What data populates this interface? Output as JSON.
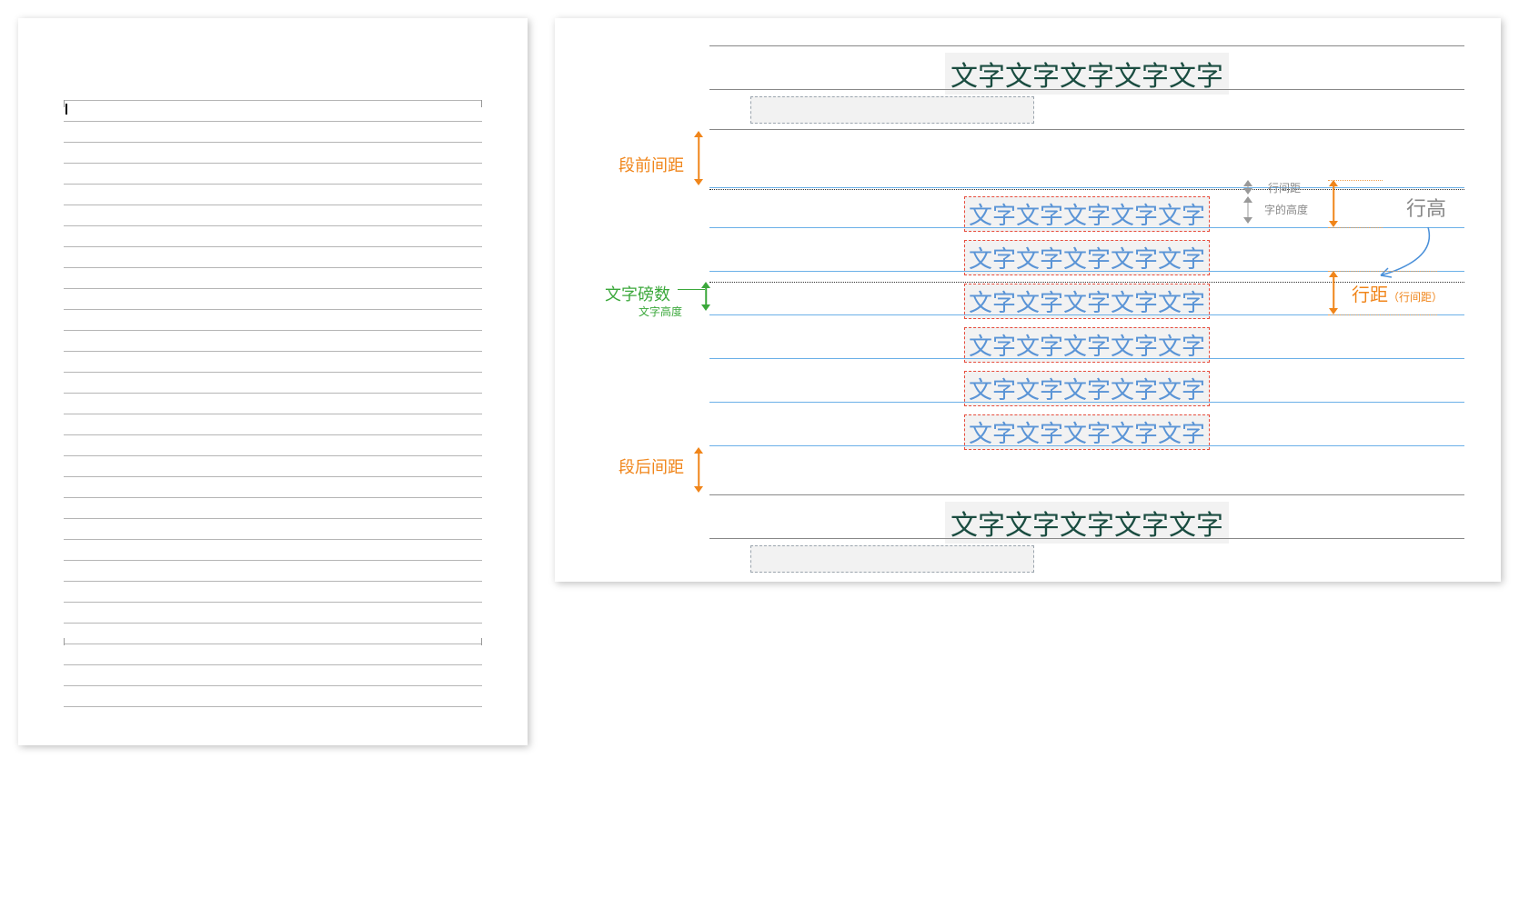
{
  "left_doc": {
    "line_count": 30
  },
  "sample_text": "文字文字文字文字文字",
  "labels": {
    "space_before": "段前间距",
    "space_after": "段后间距",
    "font_points": "文字磅数",
    "font_height_note": "文字高度",
    "line_gap": "行间距",
    "char_height": "字的高度",
    "line_height": "行高",
    "line_spacing": "行距",
    "line_spacing_note": "（行间距）"
  },
  "blue_line_count": 6
}
